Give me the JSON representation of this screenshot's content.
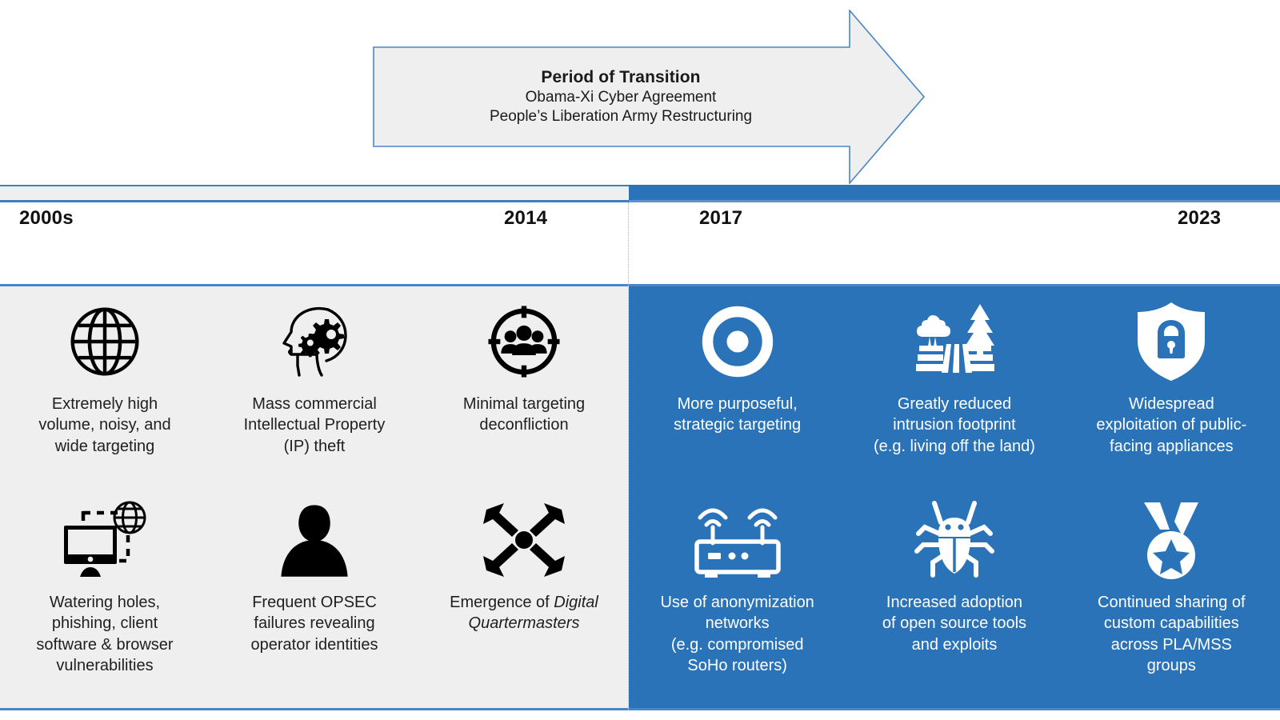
{
  "colors": {
    "accent_blue": "#2a73b8",
    "border_blue": "#4a86c5",
    "panel_grey": "#efefef",
    "arrow_fill": "#efefef",
    "icon_dark": "#000000",
    "icon_light": "#ffffff"
  },
  "transition_arrow": {
    "title": "Period of Transition",
    "line1": "Obama-Xi Cyber Agreement",
    "line2": "People’s Liberation Army Restructuring"
  },
  "timeline": {
    "years": [
      {
        "label": "2000s",
        "era": "past"
      },
      {
        "label": "2014",
        "era": "past"
      },
      {
        "label": "2017",
        "era": "present"
      },
      {
        "label": "2023",
        "era": "present"
      }
    ]
  },
  "panels": {
    "left": {
      "era": "past",
      "cells": [
        {
          "icon": "globe-grid-icon",
          "lines": [
            "Extremely high",
            "volume, noisy, and",
            "wide targeting"
          ]
        },
        {
          "icon": "head-gears-icon",
          "lines": [
            "Mass commercial",
            "Intellectual Property",
            "(IP) theft"
          ]
        },
        {
          "icon": "crosshair-people-icon",
          "lines": [
            "Minimal targeting",
            "deconfliction"
          ]
        },
        {
          "icon": "monitor-globe-icon",
          "lines": [
            "Watering holes,",
            "phishing, client",
            "software & browser",
            "vulnerabilities"
          ]
        },
        {
          "icon": "person-silhouette-icon",
          "lines": [
            "Frequent OPSEC",
            "failures revealing",
            "operator identities"
          ]
        },
        {
          "icon": "converging-arrows-icon",
          "lines": [
            "Emergence of ",
            "Digital Quartermasters"
          ],
          "plain": "Emergence of ",
          "italic": "Digital Quartermasters"
        }
      ]
    },
    "right": {
      "era": "present",
      "cells": [
        {
          "icon": "target-ring-icon",
          "lines": [
            "More purposeful,",
            "strategic targeting"
          ]
        },
        {
          "icon": "farm-field-icon",
          "lines": [
            "Greatly reduced",
            "intrusion footprint",
            "(e.g. living off the land)"
          ]
        },
        {
          "icon": "shield-lock-icon",
          "lines": [
            "Widespread",
            "exploitation of public-",
            "facing appliances"
          ]
        },
        {
          "icon": "wifi-router-icon",
          "lines": [
            "Use of anonymization",
            "networks",
            "(e.g. compromised",
            "SoHo routers)"
          ]
        },
        {
          "icon": "bug-icon",
          "lines": [
            "Increased adoption",
            "of open source tools",
            "and exploits"
          ]
        },
        {
          "icon": "medal-star-icon",
          "lines": [
            "Continued sharing of",
            "custom capabilities",
            "across PLA/MSS",
            "groups"
          ]
        }
      ]
    }
  }
}
